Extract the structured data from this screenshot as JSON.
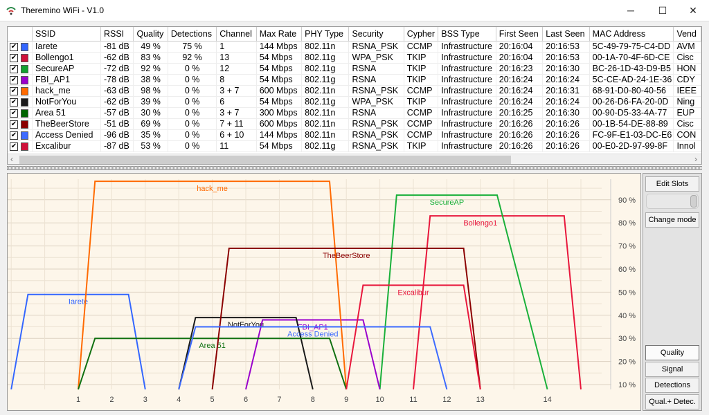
{
  "window": {
    "title": "Theremino WiFi - V1.0",
    "minimize": "─",
    "maximize": "☐",
    "close": "✕"
  },
  "table": {
    "columns": [
      "",
      "SSID",
      "RSSI",
      "Quality",
      "Detections",
      "Channel",
      "Max Rate",
      "PHY Type",
      "Security",
      "Cypher",
      "BSS Type",
      "First Seen",
      "Last Seen",
      "MAC Address",
      "Vend"
    ],
    "rows": [
      {
        "checked": true,
        "color": "#3366ff",
        "ssid": "Iarete",
        "rssi": "-81 dB",
        "quality": "49 %",
        "detections": "75 %",
        "channel": "1",
        "max_rate": "144 Mbps",
        "phy": "802.11n",
        "security": "RSNA_PSK",
        "cypher": "CCMP",
        "bss": "Infrastructure",
        "first": "20:16:04",
        "last": "20:16:53",
        "mac": "5C-49-79-75-C4-DD",
        "vendor": "AVM"
      },
      {
        "checked": true,
        "color": "#d0103a",
        "ssid": "Bollengo1",
        "rssi": "-62 dB",
        "quality": "83 %",
        "detections": "92 %",
        "channel": "13",
        "max_rate": "54 Mbps",
        "phy": "802.11g",
        "security": "WPA_PSK",
        "cypher": "TKIP",
        "bss": "Infrastructure",
        "first": "20:16:04",
        "last": "20:16:53",
        "mac": "00-1A-70-4F-6D-CE",
        "vendor": "Cisc"
      },
      {
        "checked": true,
        "color": "#12a030",
        "ssid": "SecureAP",
        "rssi": "-72 dB",
        "quality": "92 %",
        "detections": "0 %",
        "channel": "12",
        "max_rate": "54 Mbps",
        "phy": "802.11g",
        "security": "RSNA",
        "cypher": "TKIP",
        "bss": "Infrastructure",
        "first": "20:16:23",
        "last": "20:16:30",
        "mac": "BC-26-1D-43-D9-B5",
        "vendor": "HON"
      },
      {
        "checked": true,
        "color": "#9a00cc",
        "ssid": "FBI_AP1",
        "rssi": "-78 dB",
        "quality": "38 %",
        "detections": "0 %",
        "channel": "8",
        "max_rate": "54 Mbps",
        "phy": "802.11g",
        "security": "RSNA",
        "cypher": "TKIP",
        "bss": "Infrastructure",
        "first": "20:16:24",
        "last": "20:16:24",
        "mac": "5C-CE-AD-24-1E-36",
        "vendor": "CDY"
      },
      {
        "checked": true,
        "color": "#ff6a00",
        "ssid": "hack_me",
        "rssi": "-63 dB",
        "quality": "98 %",
        "detections": "0 %",
        "channel": "3 + 7",
        "max_rate": "600 Mbps",
        "phy": "802.11n",
        "security": "RSNA_PSK",
        "cypher": "CCMP",
        "bss": "Infrastructure",
        "first": "20:16:24",
        "last": "20:16:31",
        "mac": "68-91-D0-80-40-56",
        "vendor": "IEEE"
      },
      {
        "checked": true,
        "color": "#1a1a1a",
        "ssid": "NotForYou",
        "rssi": "-62 dB",
        "quality": "39 %",
        "detections": "0 %",
        "channel": "6",
        "max_rate": "54 Mbps",
        "phy": "802.11g",
        "security": "WPA_PSK",
        "cypher": "TKIP",
        "bss": "Infrastructure",
        "first": "20:16:24",
        "last": "20:16:24",
        "mac": "00-26-D6-FA-20-0D",
        "vendor": "Ning"
      },
      {
        "checked": true,
        "color": "#006400",
        "ssid": "Area 51",
        "rssi": "-57 dB",
        "quality": "30 %",
        "detections": "0 %",
        "channel": "3 + 7",
        "max_rate": "300 Mbps",
        "phy": "802.11n",
        "security": "RSNA",
        "cypher": "CCMP",
        "bss": "Infrastructure",
        "first": "20:16:25",
        "last": "20:16:30",
        "mac": "00-90-D5-33-4A-77",
        "vendor": "EUP"
      },
      {
        "checked": true,
        "color": "#8b0000",
        "ssid": "TheBeerStore",
        "rssi": "-51 dB",
        "quality": "69 %",
        "detections": "0 %",
        "channel": "7 + 11",
        "max_rate": "600 Mbps",
        "phy": "802.11n",
        "security": "RSNA_PSK",
        "cypher": "CCMP",
        "bss": "Infrastructure",
        "first": "20:16:26",
        "last": "20:16:26",
        "mac": "00-1B-54-DE-88-89",
        "vendor": "Cisc"
      },
      {
        "checked": true,
        "color": "#3d6bff",
        "ssid": "Access Denied",
        "rssi": "-96 dB",
        "quality": "35 %",
        "detections": "0 %",
        "channel": "6 + 10",
        "max_rate": "144 Mbps",
        "phy": "802.11n",
        "security": "RSNA_PSK",
        "cypher": "CCMP",
        "bss": "Infrastructure",
        "first": "20:16:26",
        "last": "20:16:26",
        "mac": "FC-9F-E1-03-DC-E6",
        "vendor": "CON"
      },
      {
        "checked": true,
        "color": "#d0103a",
        "ssid": "Excalibur",
        "rssi": "-87 dB",
        "quality": "53 %",
        "detections": "0 %",
        "channel": "11",
        "max_rate": "54 Mbps",
        "phy": "802.11g",
        "security": "RSNA_PSK",
        "cypher": "TKIP",
        "bss": "Infrastructure",
        "first": "20:16:26",
        "last": "20:16:26",
        "mac": "00-E0-2D-97-99-8F",
        "vendor": "Innol"
      }
    ],
    "scroll_left": "‹",
    "scroll_right": "›"
  },
  "panel": {
    "edit_slots": "Edit Slots",
    "change_mode": "Change mode",
    "quality": "Quality",
    "signal": "Signal",
    "detections": "Detections",
    "qual_detec": "Qual.+ Detec.",
    "active": "Quality",
    "slider_value": 1.0
  },
  "chart_data": {
    "type": "area",
    "xlabel": "",
    "ylabel": "",
    "x_ticks": [
      "1",
      "2",
      "3",
      "4",
      "5",
      "6",
      "7",
      "8",
      "9",
      "10",
      "11",
      "12",
      "13",
      "14"
    ],
    "y_ticks": [
      "10 %",
      "20 %",
      "30 %",
      "40 %",
      "50 %",
      "60 %",
      "70 %",
      "80 %",
      "90 %"
    ],
    "ylim": [
      8,
      100
    ],
    "grid": true,
    "series": [
      {
        "name": "Iarete",
        "center": 1,
        "width_mhz": 20,
        "value": 49,
        "color": "#3366ff"
      },
      {
        "name": "Bollengo1",
        "center": 13,
        "width_mhz": 20,
        "value": 83,
        "color": "#e8173c"
      },
      {
        "name": "SecureAP",
        "center": 12,
        "width_mhz": 20,
        "value": 92,
        "color": "#1ab03a"
      },
      {
        "name": "FBI_AP1",
        "center": 8,
        "width_mhz": 20,
        "value": 38,
        "color": "#9a00cc"
      },
      {
        "name": "hack_me",
        "center": 5,
        "width_mhz": 40,
        "value": 98,
        "color": "#ff6a00"
      },
      {
        "name": "NotForYou",
        "center": 6,
        "width_mhz": 20,
        "value": 39,
        "color": "#1a1a1a"
      },
      {
        "name": "Area 51",
        "center": 5,
        "width_mhz": 40,
        "value": 30,
        "color": "#107010"
      },
      {
        "name": "TheBeerStore",
        "center": 9,
        "width_mhz": 40,
        "value": 69,
        "color": "#8b0000"
      },
      {
        "name": "Access Denied",
        "center": 8,
        "width_mhz": 40,
        "value": 35,
        "color": "#3d6bff"
      },
      {
        "name": "Excalibur",
        "center": 11,
        "width_mhz": 20,
        "value": 53,
        "color": "#e8173c"
      }
    ]
  }
}
